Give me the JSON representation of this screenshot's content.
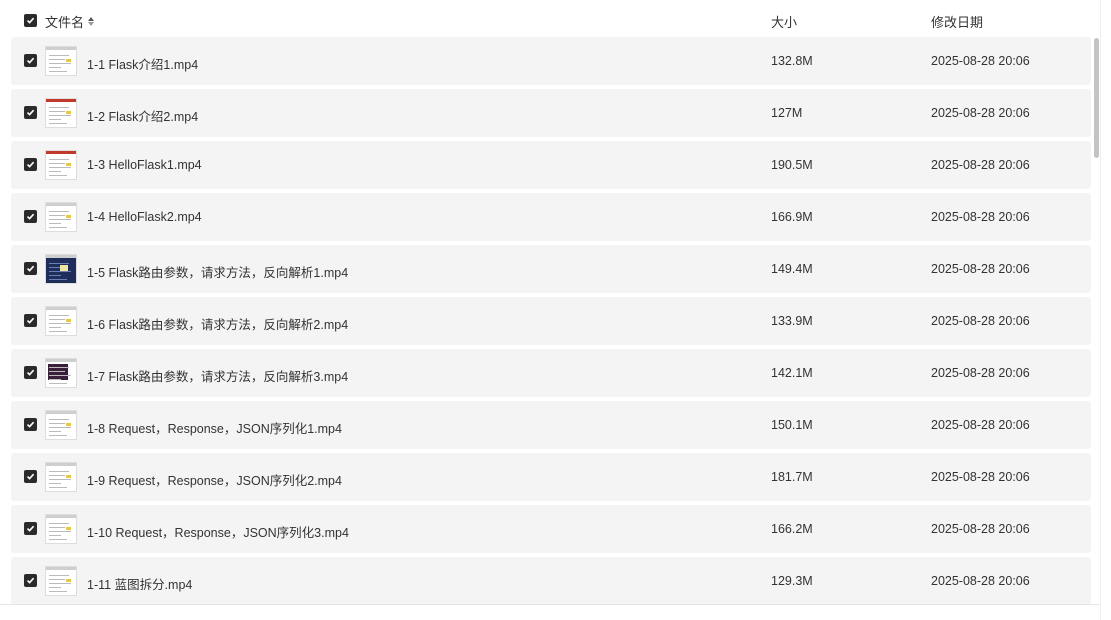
{
  "header": {
    "name_label": "文件名",
    "size_label": "大小",
    "date_label": "修改日期"
  },
  "files": [
    {
      "name": "1-1 Flask介绍1.mp4",
      "size": "132.8M",
      "date": "2025-08-28 20:06",
      "thumb": "plain"
    },
    {
      "name": "1-2 Flask介绍2.mp4",
      "size": "127M",
      "date": "2025-08-28 20:06",
      "thumb": "red"
    },
    {
      "name": "1-3 HelloFlask1.mp4",
      "size": "190.5M",
      "date": "2025-08-28 20:06",
      "thumb": "red"
    },
    {
      "name": "1-4 HelloFlask2.mp4",
      "size": "166.9M",
      "date": "2025-08-28 20:06",
      "thumb": "plain"
    },
    {
      "name": "1-5 Flask路由参数，请求方法，反向解析1.mp4",
      "size": "149.4M",
      "date": "2025-08-28 20:06",
      "thumb": "dark"
    },
    {
      "name": "1-6 Flask路由参数，请求方法，反向解析2.mp4",
      "size": "133.9M",
      "date": "2025-08-28 20:06",
      "thumb": "plain"
    },
    {
      "name": "1-7 Flask路由参数，请求方法，反向解析3.mp4",
      "size": "142.1M",
      "date": "2025-08-28 20:06",
      "thumb": "term"
    },
    {
      "name": "1-8 Request，Response，JSON序列化1.mp4",
      "size": "150.1M",
      "date": "2025-08-28 20:06",
      "thumb": "plain"
    },
    {
      "name": "1-9 Request，Response，JSON序列化2.mp4",
      "size": "181.7M",
      "date": "2025-08-28 20:06",
      "thumb": "plain"
    },
    {
      "name": "1-10 Request，Response，JSON序列化3.mp4",
      "size": "166.2M",
      "date": "2025-08-28 20:06",
      "thumb": "plain"
    },
    {
      "name": "1-11 蓝图拆分.mp4",
      "size": "129.3M",
      "date": "2025-08-28 20:06",
      "thumb": "plain"
    }
  ],
  "icons": {
    "checkbox": "checkbox-checked-icon",
    "sort": "sort-icon"
  },
  "colors": {
    "row_bg": "#f4f4f4",
    "checkbox": "#2b2b2b"
  }
}
